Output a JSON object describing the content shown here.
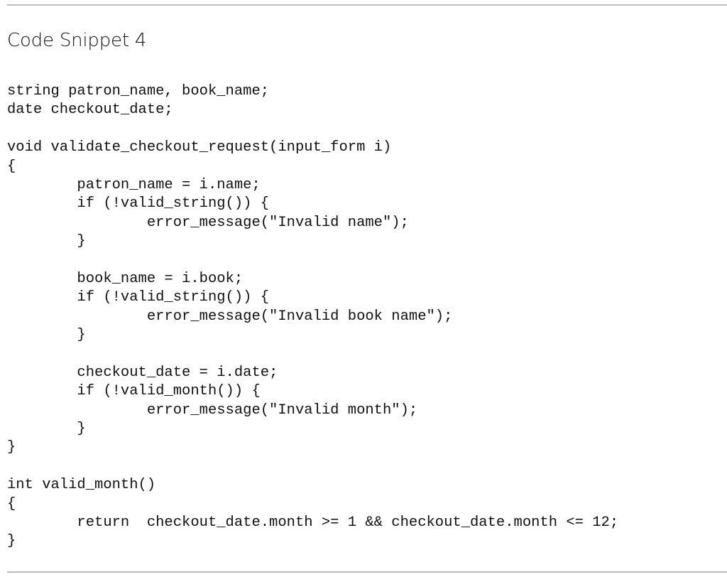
{
  "document": {
    "title": "Code Snippet 4",
    "code_lines": [
      "string patron_name, book_name;",
      "date checkout_date;",
      "",
      "void validate_checkout_request(input_form i)",
      "{",
      "        patron_name = i.name;",
      "        if (!valid_string()) {",
      "                error_message(\"Invalid name\");",
      "        }",
      "",
      "        book_name = i.book;",
      "        if (!valid_string()) {",
      "                error_message(\"Invalid book name\");",
      "        }",
      "",
      "        checkout_date = i.date;",
      "        if (!valid_month()) {",
      "                error_message(\"Invalid month\");",
      "        }",
      "}",
      "",
      "int valid_month()",
      "{",
      "        return  checkout_date.month >= 1 && checkout_date.month <= 12;",
      "}"
    ]
  }
}
